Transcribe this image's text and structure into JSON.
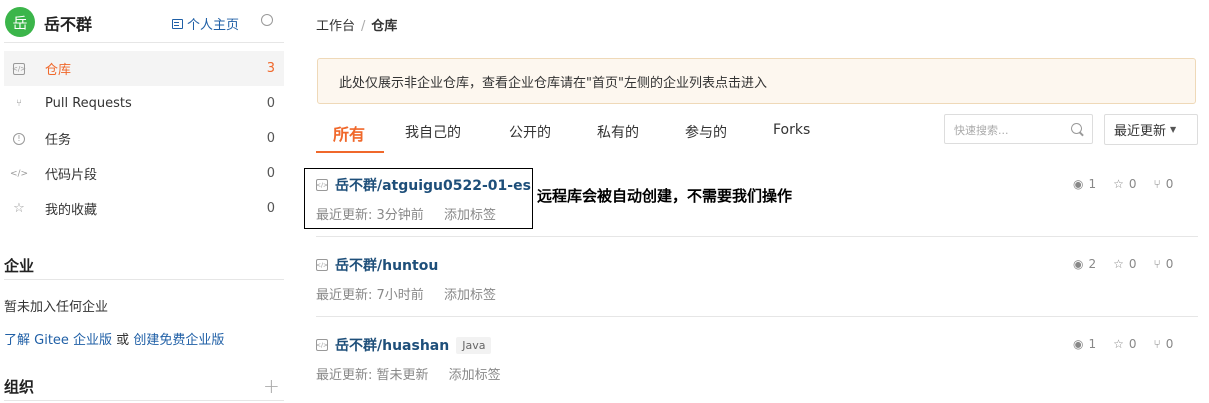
{
  "user": {
    "avatar_char": "岳",
    "name": "岳不群",
    "homepage_label": "个人主页"
  },
  "sidebar": {
    "items": [
      {
        "label": "仓库",
        "count": "3",
        "icon": "repo-icon"
      },
      {
        "label": "Pull Requests",
        "count": "0",
        "icon": "pull-request-icon"
      },
      {
        "label": "任务",
        "count": "0",
        "icon": "issue-icon"
      },
      {
        "label": "代码片段",
        "count": "0",
        "icon": "code-icon"
      },
      {
        "label": "我的收藏",
        "count": "0",
        "icon": "star-icon"
      }
    ],
    "enterprise_title": "企业",
    "enterprise_empty": "暂未加入任何企业",
    "enterprise_link1": "了解 Gitee 企业版",
    "enterprise_or": " 或 ",
    "enterprise_link2": "创建免费企业版",
    "org_title": "组织"
  },
  "breadcrumb": {
    "root": "工作台",
    "separator": "/",
    "current": "仓库"
  },
  "notice": "此处仅展示非企业仓库，查看企业仓库请在\"首页\"左侧的企业列表点击进入",
  "tabs": [
    "所有",
    "我自己的",
    "公开的",
    "私有的",
    "参与的",
    "Forks"
  ],
  "search": {
    "placeholder": "快速搜索..."
  },
  "sort": {
    "label": "最近更新"
  },
  "repos": [
    {
      "name": "岳不群/atguigu0522-01-es",
      "updated": "最近更新: 3分钟前",
      "tag_action": "添加标签",
      "watch": "1",
      "star": "0",
      "fork": "0",
      "lang": ""
    },
    {
      "name": "岳不群/huntou",
      "updated": "最近更新: 7小时前",
      "tag_action": "添加标签",
      "watch": "2",
      "star": "0",
      "fork": "0",
      "lang": ""
    },
    {
      "name": "岳不群/huashan",
      "updated": "最近更新: 暂未更新",
      "tag_action": "添加标签",
      "watch": "1",
      "star": "0",
      "fork": "0",
      "lang": "Java"
    }
  ],
  "annotation": "远程库会被自动创建，不需要我们操作",
  "colors": {
    "accent": "#f0682b",
    "link": "#1e4f7a",
    "avatar_bg": "#3bb54a",
    "notice_bg": "#fdf7ef"
  }
}
